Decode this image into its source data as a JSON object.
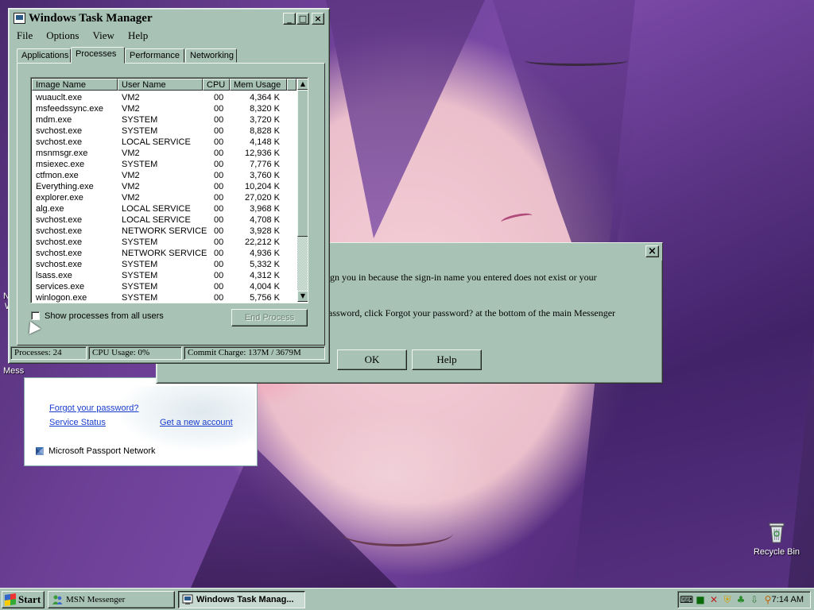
{
  "desktop": {
    "recycle_bin_label": "Recycle Bin",
    "partial_icon_label": "Mess",
    "partial_icon_label_2": "N",
    "partial_icon_label_3": "W"
  },
  "msn_dialog": {
    "close_glyph": "×",
    "line1": "sign you in because the sign-in name you entered does not exist or your",
    "line2": "password, click Forgot your password? at the bottom of the main Messenger",
    "ok_label": "OK",
    "help_label": "Help"
  },
  "msn_signin": {
    "forgot_password": "Forgot your password?",
    "service_status": "Service Status",
    "get_account": "Get a new account",
    "passport_network": "Microsoft Passport Network"
  },
  "task_manager": {
    "title": "Windows Task Manager",
    "menu": [
      "File",
      "Options",
      "View",
      "Help"
    ],
    "tabs": [
      "Applications",
      "Processes",
      "Performance",
      "Networking"
    ],
    "active_tab": "Processes",
    "columns": [
      "Image Name",
      "User Name",
      "CPU",
      "Mem Usage"
    ],
    "processes": [
      [
        "wuauclt.exe",
        "VM2",
        "00",
        "4,364 K"
      ],
      [
        "msfeedssync.exe",
        "VM2",
        "00",
        "8,320 K"
      ],
      [
        "mdm.exe",
        "SYSTEM",
        "00",
        "3,720 K"
      ],
      [
        "svchost.exe",
        "SYSTEM",
        "00",
        "8,828 K"
      ],
      [
        "svchost.exe",
        "LOCAL SERVICE",
        "00",
        "4,148 K"
      ],
      [
        "msnmsgr.exe",
        "VM2",
        "00",
        "12,936 K"
      ],
      [
        "msiexec.exe",
        "SYSTEM",
        "00",
        "7,776 K"
      ],
      [
        "ctfmon.exe",
        "VM2",
        "00",
        "3,760 K"
      ],
      [
        "Everything.exe",
        "VM2",
        "00",
        "10,204 K"
      ],
      [
        "explorer.exe",
        "VM2",
        "00",
        "27,020 K"
      ],
      [
        "alg.exe",
        "LOCAL SERVICE",
        "00",
        "3,968 K"
      ],
      [
        "svchost.exe",
        "LOCAL SERVICE",
        "00",
        "4,708 K"
      ],
      [
        "svchost.exe",
        "NETWORK SERVICE",
        "00",
        "3,928 K"
      ],
      [
        "svchost.exe",
        "SYSTEM",
        "00",
        "22,212 K"
      ],
      [
        "svchost.exe",
        "NETWORK SERVICE",
        "00",
        "4,936 K"
      ],
      [
        "svchost.exe",
        "SYSTEM",
        "00",
        "5,332 K"
      ],
      [
        "lsass.exe",
        "SYSTEM",
        "00",
        "4,312 K"
      ],
      [
        "services.exe",
        "SYSTEM",
        "00",
        "4,004 K"
      ],
      [
        "winlogon.exe",
        "SYSTEM",
        "00",
        "5,756 K"
      ]
    ],
    "show_all_users_label": "Show processes from all users",
    "show_all_users_checked": false,
    "end_process_label": "End Process",
    "status": {
      "processes": "Processes: 24",
      "cpu_usage": "CPU Usage: 0%",
      "commit_charge": "Commit Charge: 137M / 3679M"
    },
    "title_buttons": {
      "minimize": "_",
      "maximize": "□",
      "close": "×"
    }
  },
  "taskbar": {
    "start_label": "Start",
    "tasks": [
      "MSN Messenger",
      "Windows Task Manag..."
    ],
    "active_task": "Windows Task Manag...",
    "clock": "7:14 AM",
    "tray_icons": [
      "keyboard-icon",
      "task-manager-tray-icon",
      "network-icon",
      "security-shield-icon",
      "msn-icon",
      "update-icon",
      "search-icon"
    ]
  },
  "colors": {
    "window_face": "#a8c2b6",
    "link": "#1a3ccc",
    "list_bg": "#ffffff"
  }
}
